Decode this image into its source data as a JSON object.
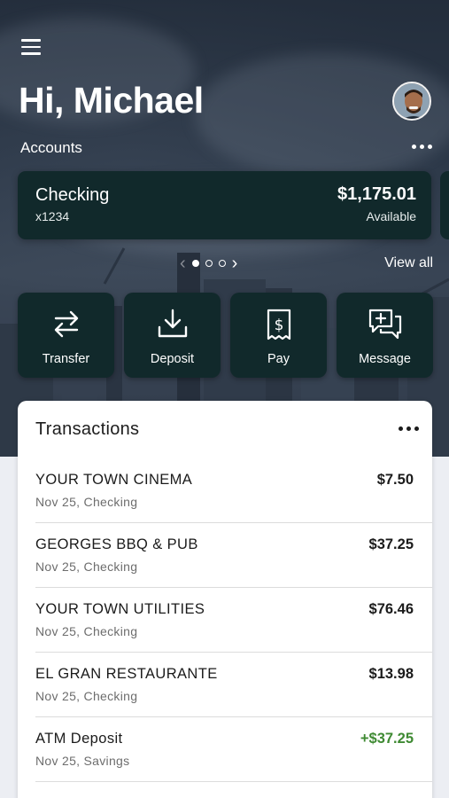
{
  "header": {
    "greeting": "Hi, Michael",
    "accounts_label": "Accounts",
    "view_all": "View all"
  },
  "account": {
    "name": "Checking",
    "number": "x1234",
    "balance": "$1,175.01",
    "balance_label": "Available"
  },
  "pager": {
    "total": 3,
    "active": 1
  },
  "actions": [
    {
      "label": "Transfer",
      "icon": "transfer-icon"
    },
    {
      "label": "Deposit",
      "icon": "deposit-icon"
    },
    {
      "label": "Pay",
      "icon": "pay-bill-icon"
    },
    {
      "label": "Message",
      "icon": "message-plus-icon"
    }
  ],
  "transactions": {
    "title": "Transactions",
    "items": [
      {
        "merchant": "YOUR TOWN CINEMA",
        "meta": "Nov 25, Checking",
        "amount": "$7.50",
        "type": "debit"
      },
      {
        "merchant": "GEORGES BBQ & PUB",
        "meta": "Nov 25, Checking",
        "amount": "$37.25",
        "type": "debit"
      },
      {
        "merchant": "YOUR TOWN UTILITIES",
        "meta": "Nov 25, Checking",
        "amount": "$76.46",
        "type": "debit"
      },
      {
        "merchant": "EL GRAN RESTAURANTE",
        "meta": "Nov 25, Checking",
        "amount": "$13.98",
        "type": "debit"
      },
      {
        "merchant": "ATM Deposit",
        "meta": "Nov 25, Savings",
        "amount": "+$37.25",
        "type": "credit"
      }
    ]
  },
  "colors": {
    "card_bg": "#11292b",
    "credit_green": "#3f8a33",
    "page_bg": "#eceef3"
  }
}
